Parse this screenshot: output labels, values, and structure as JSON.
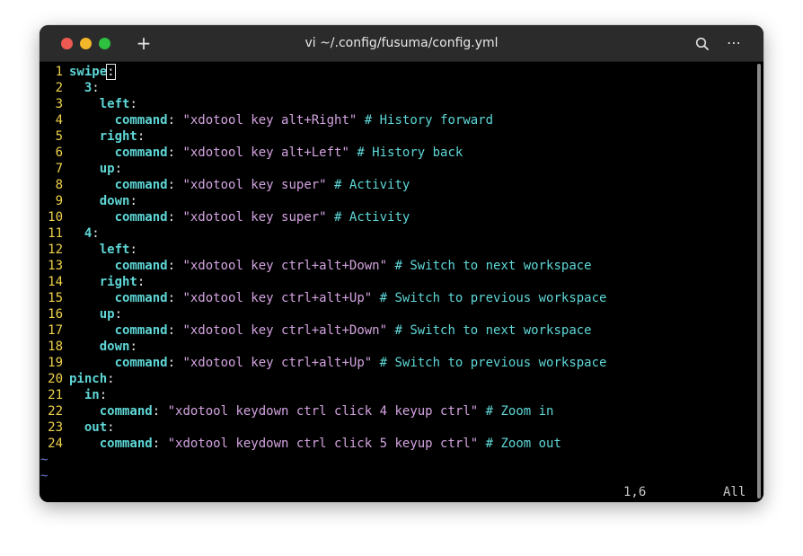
{
  "window": {
    "title": "vi ~/.config/fusuma/config.yml",
    "new_tab_label": "+",
    "menu_label": "⋯",
    "colors": {
      "titlebar": "#2b2b2b",
      "background": "#000000",
      "keyword": "#5fd7d7",
      "string": "#d3a3e0",
      "line_number": "#f0d34a",
      "tilde": "#6a7bd6"
    }
  },
  "editor": {
    "lines": [
      {
        "num": "1",
        "parts": [
          {
            "t": "swipe",
            "c": "k"
          },
          {
            "t": ":",
            "c": "cursor"
          }
        ]
      },
      {
        "num": "2",
        "parts": [
          {
            "t": "  ",
            "c": "p"
          },
          {
            "t": "3",
            "c": "k"
          },
          {
            "t": ":",
            "c": "p"
          }
        ]
      },
      {
        "num": "3",
        "parts": [
          {
            "t": "    ",
            "c": "p"
          },
          {
            "t": "left",
            "c": "k"
          },
          {
            "t": ":",
            "c": "p"
          }
        ]
      },
      {
        "num": "4",
        "parts": [
          {
            "t": "      ",
            "c": "p"
          },
          {
            "t": "command",
            "c": "k"
          },
          {
            "t": ": ",
            "c": "p"
          },
          {
            "t": "\"xdotool key alt+Right\"",
            "c": "s"
          },
          {
            "t": " # History forward",
            "c": "c"
          }
        ]
      },
      {
        "num": "5",
        "parts": [
          {
            "t": "    ",
            "c": "p"
          },
          {
            "t": "right",
            "c": "k"
          },
          {
            "t": ":",
            "c": "p"
          }
        ]
      },
      {
        "num": "6",
        "parts": [
          {
            "t": "      ",
            "c": "p"
          },
          {
            "t": "command",
            "c": "k"
          },
          {
            "t": ": ",
            "c": "p"
          },
          {
            "t": "\"xdotool key alt+Left\"",
            "c": "s"
          },
          {
            "t": " # History back",
            "c": "c"
          }
        ]
      },
      {
        "num": "7",
        "parts": [
          {
            "t": "    ",
            "c": "p"
          },
          {
            "t": "up",
            "c": "k"
          },
          {
            "t": ":",
            "c": "p"
          }
        ]
      },
      {
        "num": "8",
        "parts": [
          {
            "t": "      ",
            "c": "p"
          },
          {
            "t": "command",
            "c": "k"
          },
          {
            "t": ": ",
            "c": "p"
          },
          {
            "t": "\"xdotool key super\"",
            "c": "s"
          },
          {
            "t": " # Activity",
            "c": "c"
          }
        ]
      },
      {
        "num": "9",
        "parts": [
          {
            "t": "    ",
            "c": "p"
          },
          {
            "t": "down",
            "c": "k"
          },
          {
            "t": ":",
            "c": "p"
          }
        ]
      },
      {
        "num": "10",
        "parts": [
          {
            "t": "      ",
            "c": "p"
          },
          {
            "t": "command",
            "c": "k"
          },
          {
            "t": ": ",
            "c": "p"
          },
          {
            "t": "\"xdotool key super\"",
            "c": "s"
          },
          {
            "t": " # Activity",
            "c": "c"
          }
        ]
      },
      {
        "num": "11",
        "parts": [
          {
            "t": "  ",
            "c": "p"
          },
          {
            "t": "4",
            "c": "k"
          },
          {
            "t": ":",
            "c": "p"
          }
        ]
      },
      {
        "num": "12",
        "parts": [
          {
            "t": "    ",
            "c": "p"
          },
          {
            "t": "left",
            "c": "k"
          },
          {
            "t": ":",
            "c": "p"
          }
        ]
      },
      {
        "num": "13",
        "parts": [
          {
            "t": "      ",
            "c": "p"
          },
          {
            "t": "command",
            "c": "k"
          },
          {
            "t": ": ",
            "c": "p"
          },
          {
            "t": "\"xdotool key ctrl+alt+Down\"",
            "c": "s"
          },
          {
            "t": " # Switch to next workspace",
            "c": "c"
          }
        ]
      },
      {
        "num": "14",
        "parts": [
          {
            "t": "    ",
            "c": "p"
          },
          {
            "t": "right",
            "c": "k"
          },
          {
            "t": ":",
            "c": "p"
          }
        ]
      },
      {
        "num": "15",
        "parts": [
          {
            "t": "      ",
            "c": "p"
          },
          {
            "t": "command",
            "c": "k"
          },
          {
            "t": ": ",
            "c": "p"
          },
          {
            "t": "\"xdotool key ctrl+alt+Up\"",
            "c": "s"
          },
          {
            "t": " # Switch to previous workspace",
            "c": "c"
          }
        ]
      },
      {
        "num": "16",
        "parts": [
          {
            "t": "    ",
            "c": "p"
          },
          {
            "t": "up",
            "c": "k"
          },
          {
            "t": ":",
            "c": "p"
          }
        ]
      },
      {
        "num": "17",
        "parts": [
          {
            "t": "      ",
            "c": "p"
          },
          {
            "t": "command",
            "c": "k"
          },
          {
            "t": ": ",
            "c": "p"
          },
          {
            "t": "\"xdotool key ctrl+alt+Down\"",
            "c": "s"
          },
          {
            "t": " # Switch to next workspace",
            "c": "c"
          }
        ]
      },
      {
        "num": "18",
        "parts": [
          {
            "t": "    ",
            "c": "p"
          },
          {
            "t": "down",
            "c": "k"
          },
          {
            "t": ":",
            "c": "p"
          }
        ]
      },
      {
        "num": "19",
        "parts": [
          {
            "t": "      ",
            "c": "p"
          },
          {
            "t": "command",
            "c": "k"
          },
          {
            "t": ": ",
            "c": "p"
          },
          {
            "t": "\"xdotool key ctrl+alt+Up\"",
            "c": "s"
          },
          {
            "t": " # Switch to previous workspace",
            "c": "c"
          }
        ]
      },
      {
        "num": "20",
        "parts": [
          {
            "t": "pinch",
            "c": "k"
          },
          {
            "t": ":",
            "c": "p"
          }
        ]
      },
      {
        "num": "21",
        "parts": [
          {
            "t": "  ",
            "c": "p"
          },
          {
            "t": "in",
            "c": "k"
          },
          {
            "t": ":",
            "c": "p"
          }
        ]
      },
      {
        "num": "22",
        "parts": [
          {
            "t": "    ",
            "c": "p"
          },
          {
            "t": "command",
            "c": "k"
          },
          {
            "t": ": ",
            "c": "p"
          },
          {
            "t": "\"xdotool keydown ctrl click 4 keyup ctrl\"",
            "c": "s"
          },
          {
            "t": " # Zoom in",
            "c": "c"
          }
        ]
      },
      {
        "num": "23",
        "parts": [
          {
            "t": "  ",
            "c": "p"
          },
          {
            "t": "out",
            "c": "k"
          },
          {
            "t": ":",
            "c": "p"
          }
        ]
      },
      {
        "num": "24",
        "parts": [
          {
            "t": "    ",
            "c": "p"
          },
          {
            "t": "command",
            "c": "k"
          },
          {
            "t": ": ",
            "c": "p"
          },
          {
            "t": "\"xdotool keydown ctrl click 5 keyup ctrl\"",
            "c": "s"
          },
          {
            "t": " # Zoom out",
            "c": "c"
          }
        ]
      }
    ],
    "tildes": [
      "~",
      "~"
    ],
    "status": {
      "position": "1,6",
      "scroll": "All"
    }
  }
}
